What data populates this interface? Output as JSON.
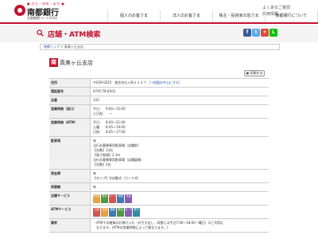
{
  "header": {
    "logo_sub": "● ひと・ゆめ・まち ●",
    "logo_name": "南都銀行",
    "logo_code": "金融機関コード0162",
    "links": [
      "よくあるご質問",
      "採用情報"
    ]
  },
  "nav": [
    "個人のお客さま",
    "法人のお客さま",
    "株主・投資家の皆さま",
    "南都銀行について"
  ],
  "page": {
    "title": "店舗・ATM検索"
  },
  "share": {
    "buttons": [
      "f",
      "t",
      "+",
      "L"
    ]
  },
  "breadcrumb": {
    "home": "南都トップ",
    "sep": " > ",
    "current": "真美ヶ丘支店"
  },
  "branch": {
    "badge": "南",
    "name": "真美ヶ丘支店"
  },
  "print_label": "印刷する",
  "table": {
    "address_label": "住所",
    "address_value": "〒639-0225　香芝市五ヶ所２１４７",
    "map_link": "［→地図の中心にする］",
    "phone_label": "電話番号",
    "phone_value": "0745-78-8101",
    "store_no_label": "店番",
    "store_no_value": "333",
    "hours_label": "営業時間（窓口）",
    "hours_lines": [
      "平日：　9:00～15:00",
      "土日祝：　—"
    ],
    "atm_hours_label": "営業時間（ATM）",
    "atm_hours_lines": [
      "平日：　8:00～21:00",
      "土曜：　8:45～19:00",
      "日祝：　8:45～17:00"
    ],
    "parking_label": "駐車場",
    "parking_lines": [
      "有",
      "当行お客様専用駐車場（店舗前）",
      "【台数】13台",
      "【高さ制限】2.1m",
      "当行お客様専用駐車場（店舗裏側）",
      "【台数】2台"
    ],
    "safe_label": "貸金庫",
    "safe_lines": [
      "有",
      "【タイプ】半自動式（カード式）"
    ],
    "night_label": "両替機",
    "night_value": "有",
    "services_label": "店舗サービス",
    "services": [
      {
        "text": "外貨両替",
        "color": "#e8a33c"
      },
      {
        "text": "投信",
        "color": "#4c9a3c"
      },
      {
        "text": "ローン",
        "color": "#d9534f"
      },
      {
        "text": "保険",
        "color": "#3c7ab8"
      },
      {
        "text": "年金",
        "color": "#8a5cb8"
      }
    ],
    "atm_services_label": "ATMサービス",
    "atm_services": [
      {
        "text": "土曜",
        "color": "#d9534f"
      },
      {
        "text": "日祝",
        "color": "#e8a33c"
      },
      {
        "text": "通帳",
        "color": "#3c7ab8"
      },
      {
        "text": "振込",
        "color": "#4c9a3c"
      },
      {
        "text": "カード",
        "color": "#8a5cb8"
      },
      {
        "text": "電子",
        "color": "#2e8fa8"
      }
    ],
    "note_label": "備考",
    "note_lines": [
      "・ATMでの硬貨のお預け入れ・お引き出し、両替には平日7:00～18:00（曜日）のご利用に",
      "　なります。(ATMの営業時間によって異なります。)"
    ]
  }
}
